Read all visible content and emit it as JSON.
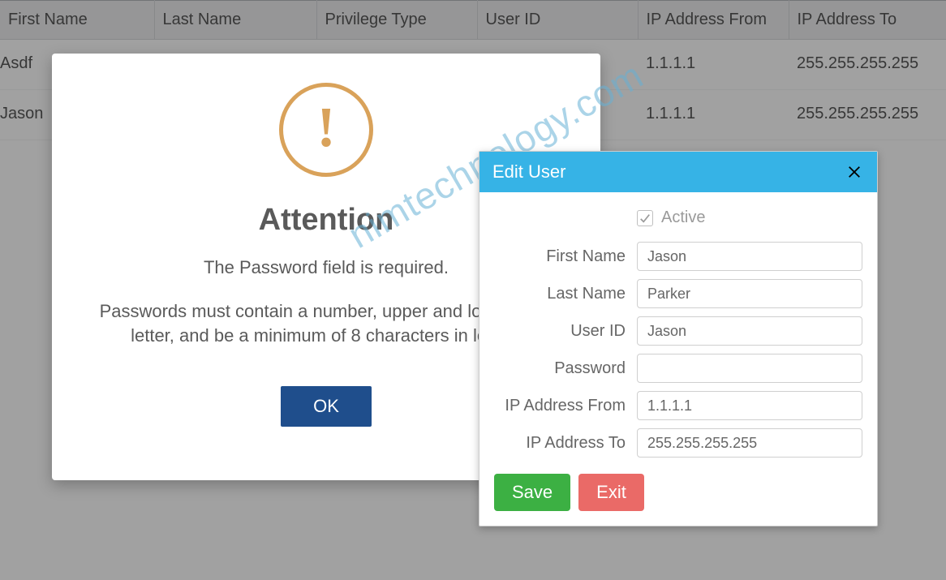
{
  "watermark": "nimtechnology.com",
  "table": {
    "columns": [
      "First Name",
      "Last Name",
      "Privilege Type",
      "User ID",
      "IP Address From",
      "IP Address To"
    ],
    "rows": [
      {
        "first_name": "Asdf",
        "last_name": "",
        "privilege_type": "",
        "user_id": "",
        "ip_from": "1.1.1.1",
        "ip_to": "255.255.255.255"
      },
      {
        "first_name": "Jason",
        "last_name": "",
        "privilege_type": "",
        "user_id": "",
        "ip_from": "1.1.1.1",
        "ip_to": "255.255.255.255"
      }
    ]
  },
  "attention": {
    "title": "Attention",
    "line1": "The Password field is required.",
    "line2": "Passwords must contain a number, upper and lower case letter, and be a minimum of 8 characters in length",
    "ok_label": "OK"
  },
  "edit_dialog": {
    "title": "Edit User",
    "active_label": "Active",
    "active_checked": true,
    "labels": {
      "first_name": "First Name",
      "last_name": "Last Name",
      "user_id": "User ID",
      "password": "Password",
      "ip_from": "IP Address From",
      "ip_to": "IP Address To"
    },
    "values": {
      "first_name": "Jason",
      "last_name": "Parker",
      "user_id": "Jason",
      "password": "",
      "ip_from": "1.1.1.1",
      "ip_to": "255.255.255.255"
    },
    "save_label": "Save",
    "exit_label": "Exit"
  },
  "colors": {
    "header_blue": "#36b3e6",
    "ok_button": "#1f4e8c",
    "save_green": "#3cb043",
    "exit_red": "#ea6a67",
    "warning_orange": "#d9a25a"
  }
}
